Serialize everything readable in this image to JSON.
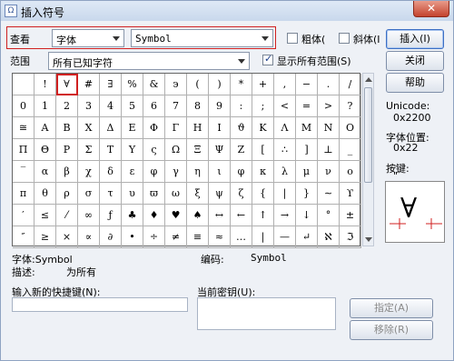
{
  "window": {
    "title": "插入符号",
    "close_glyph": "✕",
    "app_icon_glyph": "Ω"
  },
  "toolbar": {
    "view_label": "查看",
    "view_mode": "字体",
    "font_value": "Symbol",
    "bold_label": "粗体(",
    "italic_label": "斜体(I",
    "scope_label": "范围",
    "range_value": "所有已知字符",
    "show_all_label": "显示所有范围(S)",
    "show_all_checked": true
  },
  "buttons": {
    "insert": "插入(I)",
    "close": "关闭",
    "help": "帮助",
    "assign": "指定(A)",
    "remove": "移除(R)"
  },
  "symbols": [
    [
      "",
      "!",
      "∀",
      "#",
      "∃",
      "%",
      "&",
      "϶",
      "(",
      ")",
      "*",
      "+",
      ",",
      "−",
      ".",
      "/"
    ],
    [
      "0",
      "1",
      "2",
      "3",
      "4",
      "5",
      "6",
      "7",
      "8",
      "9",
      ":",
      ";",
      "<",
      "=",
      ">",
      "?"
    ],
    [
      "≅",
      "Α",
      "Β",
      "Χ",
      "Δ",
      "Ε",
      "Φ",
      "Γ",
      "Η",
      "Ι",
      "ϑ",
      "Κ",
      "Λ",
      "Μ",
      "Ν",
      "Ο"
    ],
    [
      "Π",
      "Θ",
      "Ρ",
      "Σ",
      "Τ",
      "Υ",
      "ς",
      "Ω",
      "Ξ",
      "Ψ",
      "Ζ",
      "[",
      "∴",
      "]",
      "⊥",
      "_"
    ],
    [
      "‾",
      "α",
      "β",
      "χ",
      "δ",
      "ε",
      "φ",
      "γ",
      "η",
      "ι",
      "φ",
      "κ",
      "λ",
      "μ",
      "ν",
      "ο"
    ],
    [
      "π",
      "θ",
      "ρ",
      "σ",
      "τ",
      "υ",
      "ϖ",
      "ω",
      "ξ",
      "ψ",
      "ζ",
      "{",
      "|",
      "}",
      "∼",
      "ϒ"
    ],
    [
      "′",
      "≤",
      "⁄",
      "∞",
      "ƒ",
      "♣",
      "♦",
      "♥",
      "♠",
      "↔",
      "←",
      "↑",
      "→",
      "↓",
      "°",
      "±"
    ],
    [
      "″",
      "≥",
      "×",
      "∝",
      "∂",
      "•",
      "÷",
      "≠",
      "≡",
      "≈",
      "…",
      "|",
      "—",
      "↵",
      "ℵ",
      "ℑ"
    ]
  ],
  "info": {
    "unicode_label": "Unicode:",
    "unicode_value": "0x2200",
    "font_pos_label": "字体位置:",
    "font_pos_value": "0x22",
    "key_label": "按键:",
    "key_value": "\"",
    "preview_glyph": "∀"
  },
  "status": {
    "font_label": "字体:Symbol",
    "code_label": "编码:",
    "code_value": "Symbol",
    "desc_label": "描述:",
    "desc_value": "为所有"
  },
  "shortcut": {
    "new_label": "输入新的快捷键(N):",
    "current_label": "当前密钥(U):",
    "new_value": ""
  }
}
